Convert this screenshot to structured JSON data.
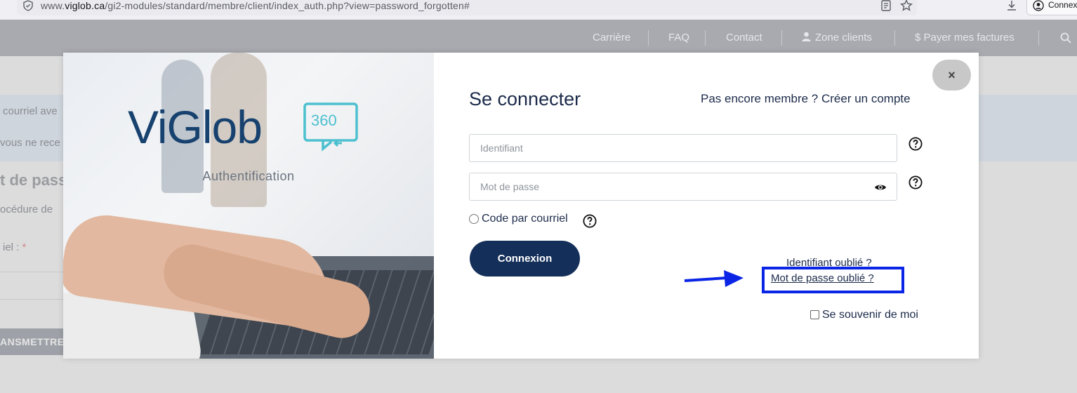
{
  "browser": {
    "url_prefix": "www.",
    "url_domain": "viglob.ca",
    "url_path": "/gi2-modules/standard/membre/client/index_auth.php?view=password_forgotten#",
    "account_label": "Connex"
  },
  "nav": {
    "items": [
      "Carrière",
      "FAQ",
      "Contact",
      "Zone clients",
      "$ Payer mes factures"
    ]
  },
  "background": {
    "info_line1": "courriel ave",
    "info_line2": "vous ne rece",
    "heading": "t de pass",
    "procedure": "océdure de",
    "field_label": "iel :",
    "required_mark": "*",
    "submit": "ANSMETTRE"
  },
  "modal": {
    "logo_text": "ViGlob",
    "logo_badge": "360",
    "auth_caption": "Authentification",
    "title": "Se connecter",
    "signup_prompt": "Pas encore membre ? Créer un compte",
    "close": "×",
    "username_placeholder": "Identifiant",
    "password_placeholder": "Mot de passe",
    "code_option": "Code par courriel",
    "login_button": "Connexion",
    "forgot_id": "Identifiant oublié ?",
    "forgot_password": "Mot de passe oublié ?",
    "remember_me": "Se souvenir de moi"
  },
  "colors": {
    "primary": "#14305a",
    "highlight": "#0a25e6",
    "logo_blue": "#17426f",
    "logo_teal": "#4cc0cf"
  }
}
